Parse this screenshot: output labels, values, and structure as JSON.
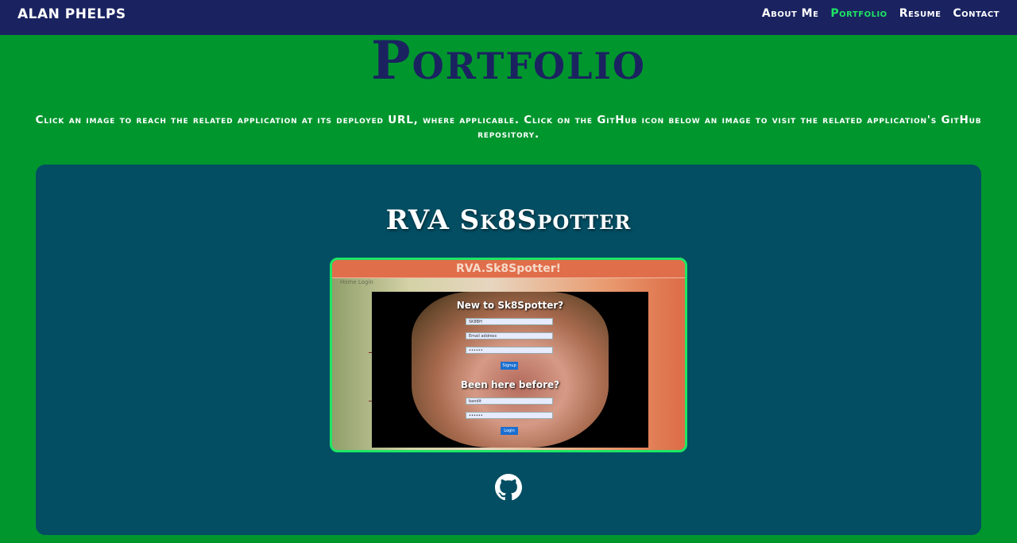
{
  "nav": {
    "brand": "ALAN PHELPS",
    "links": [
      {
        "label": "About Me",
        "active": false
      },
      {
        "label": "Portfolio",
        "active": true
      },
      {
        "label": "Resume",
        "active": false
      },
      {
        "label": "Contact",
        "active": false
      }
    ]
  },
  "page": {
    "title": "Portfolio",
    "intro": "Click an image to reach the related application at its deployed URL, where applicable. Click on the GitHub icon below an image to visit the related application's GitHub repository."
  },
  "projects": [
    {
      "title": "RVA Sk8Spotter",
      "screenshot": {
        "header": "RVA.Sk8Spotter!",
        "nav_text": "Home Login",
        "signup_title": "New to Sk8Spotter?",
        "signup_inputs": [
          "SK8BH",
          "Email address",
          "••••••"
        ],
        "signup_button": "Signup",
        "login_title": "Been here before?",
        "login_inputs": [
          "bandit",
          "••••••"
        ],
        "login_button": "Login"
      },
      "github_icon": "github-icon"
    }
  ],
  "colors": {
    "background": "#00962e",
    "navbar": "#1a2360",
    "card": "#034e63",
    "accent": "#1ee664",
    "title": "#1a2360"
  }
}
